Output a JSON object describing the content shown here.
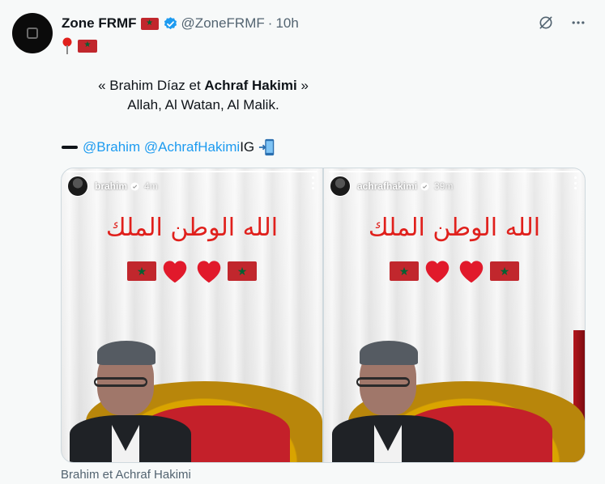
{
  "tweet": {
    "author_name": "Zone FRMF",
    "handle": "@ZoneFRMF",
    "separator": "·",
    "time": "10h",
    "line1_before": "« Brahim Díaz et ",
    "line1_bold": "Achraf Hakimi",
    "line1_after": " »",
    "line2": "Allah, Al Watan, Al Malik.",
    "mention1": "@Brahim",
    "mention2": "@AchrafHakimi",
    "mentions_suffix": " IG"
  },
  "media": {
    "panels": [
      {
        "user": "brahim",
        "time": "4m",
        "arabic": "الله الوطن الملك"
      },
      {
        "user": "achrafhakimi",
        "time": "39m",
        "arabic": "الله الوطن الملك"
      }
    ],
    "caption": "Brahim et Achraf Hakimi"
  },
  "icons": {
    "author_flag": "morocco-flag-icon",
    "verified": "verified-badge-icon",
    "grok": "grok-icon",
    "more": "more-icon",
    "pin": "pin-icon",
    "dash": "dash-icon",
    "phone": "phone-arrow-icon",
    "heart": "red-heart-icon"
  },
  "colors": {
    "accent": "#1d9bf0",
    "text": "#0f1419",
    "muted": "#536471",
    "flag_red": "#c1272d",
    "flag_green": "#006233",
    "arabic_red": "#e0201c"
  }
}
